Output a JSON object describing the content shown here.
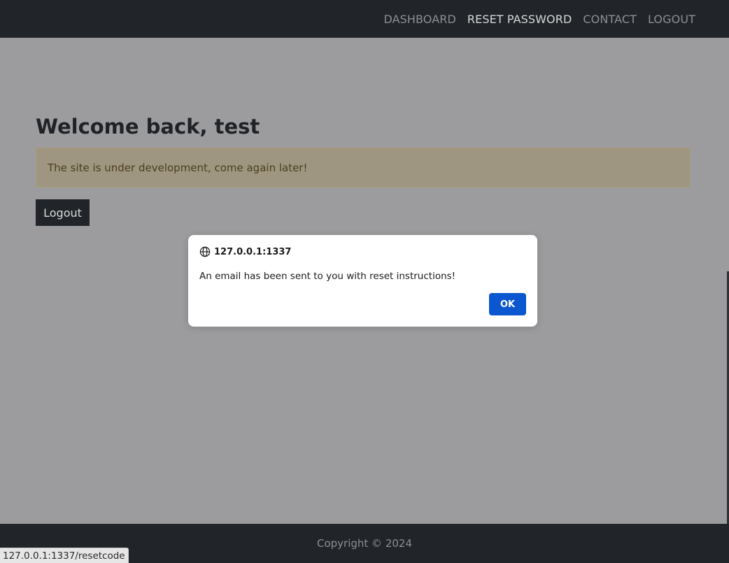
{
  "nav": {
    "items": [
      {
        "label": "DASHBOARD"
      },
      {
        "label": "RESET PASSWORD"
      },
      {
        "label": "CONTACT"
      },
      {
        "label": "LOGOUT"
      }
    ]
  },
  "main": {
    "welcome": "Welcome back, test",
    "alert": "The site is under development, come again later!",
    "logout_button": "Logout"
  },
  "dialog": {
    "origin": "127.0.0.1:1337",
    "message": "An email has been sent to you with reset instructions!",
    "ok_label": "OK"
  },
  "footer": {
    "copyright": "Copyright © 2024"
  },
  "status_bar": {
    "url": "127.0.0.1:1337/resetcode"
  },
  "icons": {
    "dialog_origin": "globe-icon"
  },
  "colors": {
    "navbar": "#212529",
    "ok_button": "#0b57d0"
  }
}
